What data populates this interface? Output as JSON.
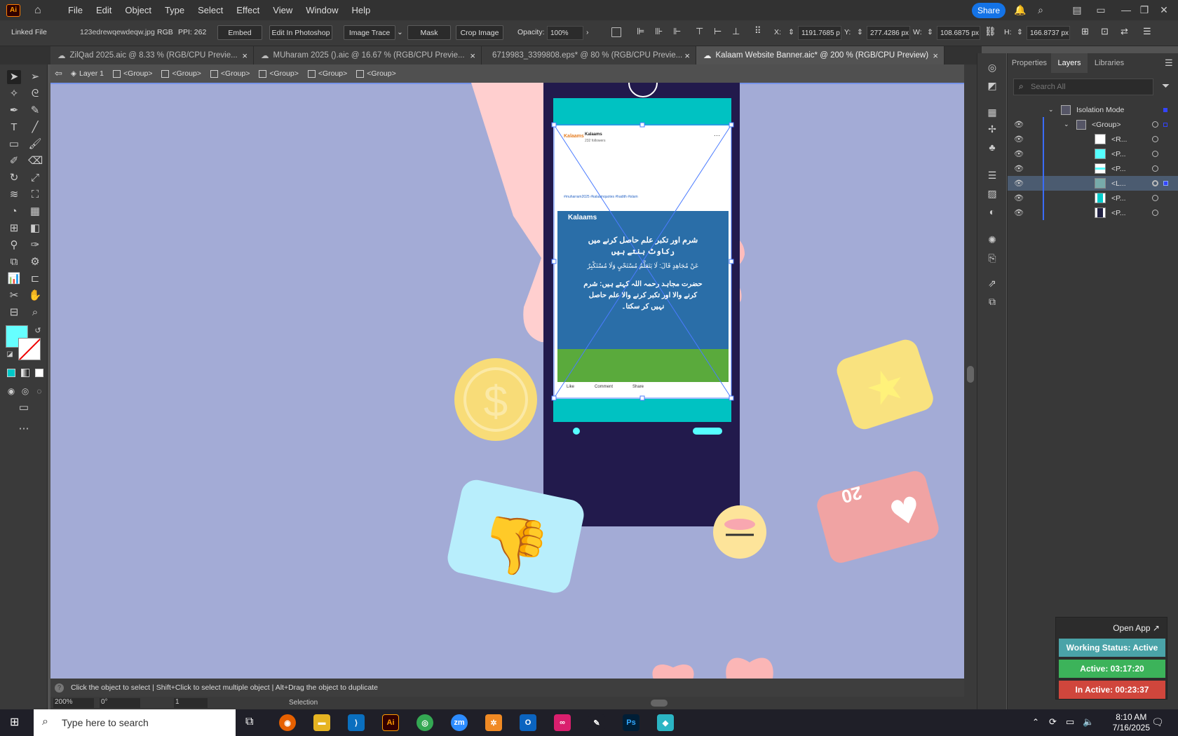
{
  "menubar": {
    "logo": "Ai",
    "items": [
      "File",
      "Edit",
      "Object",
      "Type",
      "Select",
      "Effect",
      "View",
      "Window",
      "Help"
    ],
    "share": "Share"
  },
  "control": {
    "linked_file": "Linked File",
    "filename": "123edrewqewdeqw.jpg",
    "color_mode": "RGB",
    "ppi": "PPI: 262",
    "embed": "Embed",
    "edit_photoshop": "Edit In Photoshop",
    "image_trace": "Image Trace",
    "mask": "Mask",
    "crop": "Crop Image",
    "opacity_label": "Opacity:",
    "opacity": "100%",
    "x_label": "X:",
    "x": "1191.7685 p",
    "y_label": "Y:",
    "y": "277.4286 px",
    "w_label": "W:",
    "w": "108.6875 px",
    "h_label": "H:",
    "h": "166.8737 px"
  },
  "tabs": [
    {
      "label": "ZilQad 2025.aic @ 8.33 % (RGB/CPU Previe..."
    },
    {
      "label": "MUharam 2025 ().aic @ 16.67 % (RGB/CPU Previe..."
    },
    {
      "label": "6719983_3399808.eps* @ 80 % (RGB/CPU Previe..."
    },
    {
      "label": "Kalaam Website Banner.aic* @ 200 % (RGB/CPU Preview)"
    }
  ],
  "breadcrumb": {
    "layer": "Layer 1",
    "groups": [
      "<Group>",
      "<Group>",
      "<Group>",
      "<Group>",
      "<Group>",
      "<Group>"
    ]
  },
  "artwork": {
    "brand": "Kalaams",
    "post_name": "Kalaams",
    "post_meta": "232 followers",
    "heading1": "شرم اور تکبر علم حاصل کرنے میں",
    "heading2": "رکاوٹ بنتے ہیں",
    "arabic": "عَنْ مُجَاهِدٍ قَالَ: لَا يَتَعَلَّمُ مُسْتَحْيٍ وَلَا مُسْتَكْبِرٌ",
    "body1": "حضرت مجاہد رحمہ اللہ کہتے ہیں: شرم",
    "body2": "کرنے والا اور تکبر کرنے والا علم حاصل",
    "body3": "نہیں کر سکتا۔",
    "like": "Like",
    "comment": "Comment",
    "share": "Share",
    "hashtags": "#muharram2025 #kalaamquotes #hadith #islam",
    "badge_number": "20"
  },
  "status": {
    "hint": "Click the object to select  |  Shift+Click to select multiple object  |  Alt+Drag the object to duplicate",
    "zoom": "200%",
    "rotation": "0°",
    "artboard": "1",
    "tool": "Selection"
  },
  "panel": {
    "tabs": [
      "Properties",
      "Layers",
      "Libraries"
    ],
    "search_placeholder": "Search All",
    "isolation": "Isolation Mode",
    "group": "<Group>",
    "rows": [
      "<R...",
      "<P...",
      "<P...",
      "<L...",
      "<P...",
      "<P..."
    ]
  },
  "widget": {
    "open_app": "Open App ↗",
    "status": "Working Status: Active",
    "active": "Active: 03:17:20",
    "inactive": "In Active: 00:23:37"
  },
  "taskbar": {
    "search": "Type here to search",
    "time": "8:10 AM",
    "date": "7/16/2025"
  }
}
